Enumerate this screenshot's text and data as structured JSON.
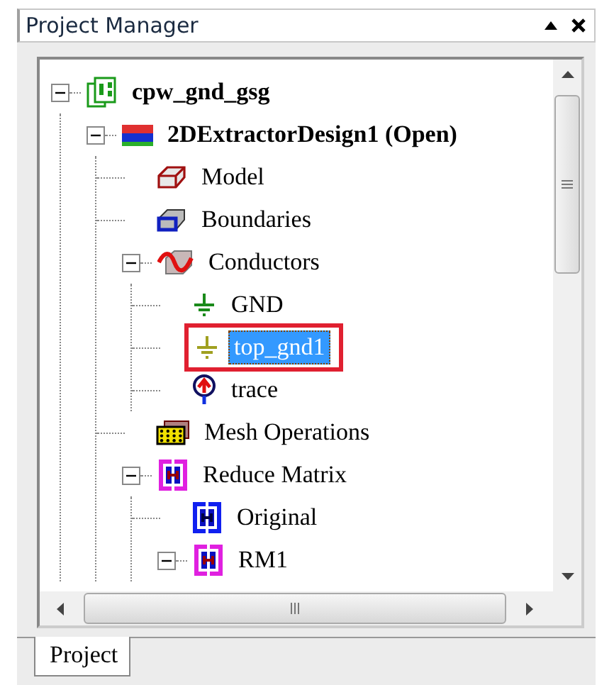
{
  "panel": {
    "title": "Project Manager"
  },
  "tree": [
    {
      "label": "cpw_gnd_gsg",
      "kind": "project",
      "bold": true,
      "expanded": true,
      "selected": false,
      "highlighted": false,
      "children": [
        {
          "label": "2DExtractorDesign1 (Open)",
          "kind": "design",
          "bold": true,
          "expanded": true,
          "selected": false,
          "highlighted": false,
          "children": [
            {
              "label": "Model",
              "kind": "model",
              "bold": false,
              "selected": false,
              "highlighted": false
            },
            {
              "label": "Boundaries",
              "kind": "boundaries",
              "bold": false,
              "selected": false,
              "highlighted": false
            },
            {
              "label": "Conductors",
              "kind": "conductors",
              "bold": false,
              "expanded": true,
              "selected": false,
              "highlighted": false,
              "children": [
                {
                  "label": "GND",
                  "kind": "ground",
                  "bold": false,
                  "selected": false,
                  "highlighted": false
                },
                {
                  "label": "top_gnd1",
                  "kind": "ground-faint",
                  "bold": false,
                  "selected": true,
                  "highlighted": true
                },
                {
                  "label": "trace",
                  "kind": "signal",
                  "bold": false,
                  "selected": false,
                  "highlighted": false
                }
              ]
            },
            {
              "label": "Mesh Operations",
              "kind": "mesh",
              "bold": false,
              "selected": false,
              "highlighted": false
            },
            {
              "label": "Reduce Matrix",
              "kind": "matrix",
              "bold": false,
              "expanded": true,
              "selected": false,
              "highlighted": false,
              "children": [
                {
                  "label": "Original",
                  "kind": "matrix-blue",
                  "bold": false,
                  "selected": false,
                  "highlighted": false
                },
                {
                  "label": "RM1",
                  "kind": "matrix",
                  "bold": false,
                  "expanded": true,
                  "selected": false,
                  "highlighted": false
                }
              ]
            }
          ]
        }
      ]
    }
  ],
  "tabs": [
    {
      "label": "Project",
      "selected": true
    }
  ]
}
